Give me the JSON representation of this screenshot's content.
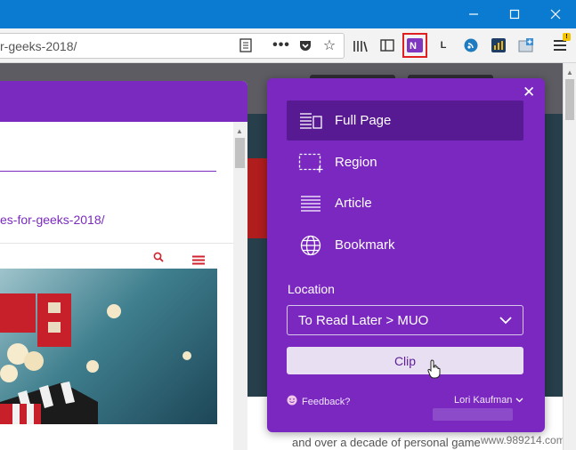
{
  "browser": {
    "url_fragment": "r-geeks-2018/",
    "window_controls": [
      "minimize",
      "maximize",
      "close"
    ]
  },
  "page": {
    "link_text": "es-for-geeks-2018/",
    "footer_text": "and over a decade of personal game",
    "watermark": "www.989214.com"
  },
  "clipper": {
    "close_icon": "close-icon",
    "options": [
      {
        "label": "Full Page",
        "icon": "full-page-icon",
        "selected": true
      },
      {
        "label": "Region",
        "icon": "region-icon",
        "selected": false
      },
      {
        "label": "Article",
        "icon": "article-icon",
        "selected": false
      },
      {
        "label": "Bookmark",
        "icon": "globe-icon",
        "selected": false
      }
    ],
    "location_label": "Location",
    "location_value": "To Read Later > MUO",
    "clip_label": "Clip",
    "feedback_label": "Feedback?",
    "user_name": "Lori Kaufman"
  },
  "colors": {
    "panel": "#7a28c0",
    "selected": "#571a93",
    "titlebar": "#0a7bd1"
  }
}
